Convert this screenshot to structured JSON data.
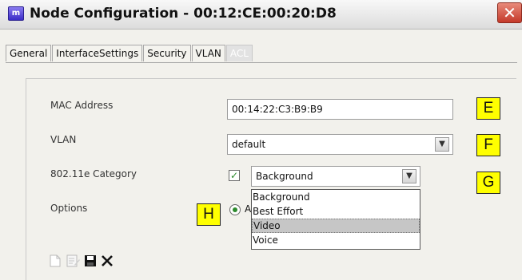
{
  "window": {
    "title": "Node Configuration - 00:12:CE:00:20:D8",
    "app_icon_glyph": "m",
    "close_glyph": "✕"
  },
  "tabs": [
    {
      "label": "General"
    },
    {
      "label": "InterfaceSettings"
    },
    {
      "label": "Security"
    },
    {
      "label": "VLAN"
    },
    {
      "label": "ACL",
      "active": true
    }
  ],
  "form": {
    "mac_label": "MAC Address",
    "mac_value": "00:14:22:C3:B9:B9",
    "vlan_label": "VLAN",
    "vlan_value": "default",
    "category_label": "802.11e Category",
    "category_value": "Background",
    "category_checked": true,
    "options_label": "Options",
    "options_radio_text": "A"
  },
  "dropdown": {
    "options": [
      "Background",
      "Best Effort",
      "Video",
      "Voice"
    ],
    "highlighted_index": 2
  },
  "annotations": {
    "e": "E",
    "f": "F",
    "g": "G",
    "h": "H"
  },
  "toolbar": {
    "icons": [
      "new-document-icon",
      "edit-icon",
      "save-icon",
      "delete-icon"
    ]
  },
  "colors": {
    "annotation_bg": "#ffff00",
    "close_button": "#c4392a",
    "checkmark": "#2c8a2c"
  }
}
